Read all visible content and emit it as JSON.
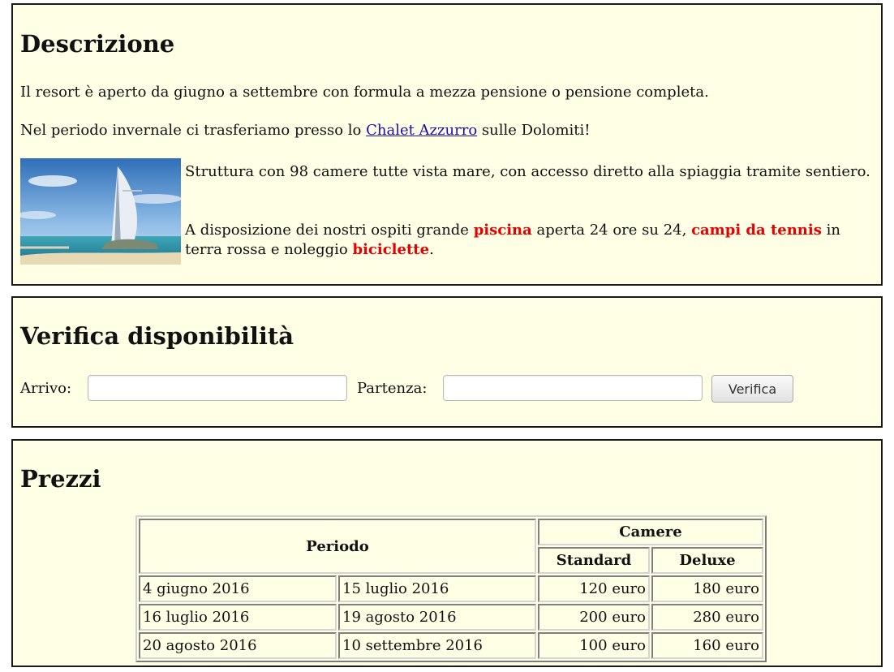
{
  "description": {
    "title": "Descrizione",
    "para1": "Il resort è aperto da giugno a settembre con formula a mezza pensione o pensione completa.",
    "para2_before": "Nel periodo invernale ci trasferiamo presso lo ",
    "para2_link": "Chalet Azzurro",
    "para2_after": " sulle Dolomiti!",
    "features_line1": "Struttura con 98 camere tutte vista mare, con accesso diretto alla spiaggia tramite sentiero.",
    "features_line2_a": "A disposizione dei nostri ospiti grande ",
    "features_line2_b": "piscina",
    "features_line2_c": " aperta 24 ore su 24, ",
    "features_line2_d": "campi da tennis",
    "features_line2_e": " in terra rossa e noleggio ",
    "features_line2_f": "biciclette",
    "features_line2_g": ".",
    "highlight_color": "#e60000",
    "link_color": "#1a0dab"
  },
  "verify": {
    "title": "Verifica disponibilità",
    "arrival_label": "Arrivo:",
    "arrival_value": "",
    "departure_label": "Partenza:",
    "departure_value": "",
    "button_label": "Verifica"
  },
  "prices": {
    "title": "Prezzi",
    "header_period": "Periodo",
    "header_rooms": "Camere",
    "header_standard": "Standard",
    "header_deluxe": "Deluxe",
    "rows": [
      {
        "from": "4 giugno 2016",
        "to": "15 luglio 2016",
        "standard": "120 euro",
        "deluxe": "180 euro"
      },
      {
        "from": "16 luglio 2016",
        "to": "19 agosto 2016",
        "standard": "200 euro",
        "deluxe": "280 euro"
      },
      {
        "from": "20 agosto 2016",
        "to": "10 settembre 2016",
        "standard": "100 euro",
        "deluxe": "160 euro"
      }
    ]
  },
  "colors": {
    "panel_background": "#ffffe6",
    "panel_border": "#1a1a1a"
  }
}
